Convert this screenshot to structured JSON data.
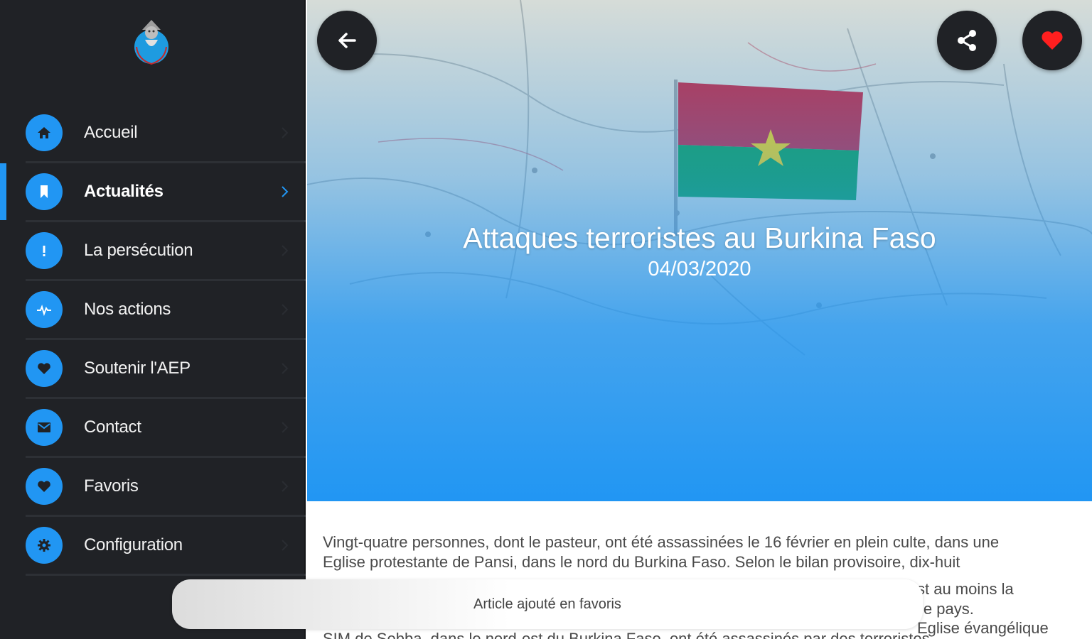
{
  "sidebar": {
    "items": [
      {
        "label": "Accueil",
        "icon": "home-icon"
      },
      {
        "label": "Actualités",
        "icon": "bookmark-icon",
        "active": true
      },
      {
        "label": "La persécution",
        "icon": "exclamation-icon"
      },
      {
        "label": "Nos actions",
        "icon": "pulse-icon"
      },
      {
        "label": "Soutenir l'AEP",
        "icon": "heart-icon"
      },
      {
        "label": "Contact",
        "icon": "mail-icon"
      },
      {
        "label": "Favoris",
        "icon": "heart-icon"
      },
      {
        "label": "Configuration",
        "icon": "gear-icon"
      }
    ]
  },
  "hero": {
    "title": "Attaques terroristes au Burkina Faso",
    "date": "04/03/2020"
  },
  "article": {
    "line1": "Vingt-quatre personnes, dont le pasteur, ont été assassinées le 16 février en plein culte, dans une",
    "line2": "Eglise protestante de Pansi, dans le nord du Burkina Faso. Selon le bilan provisoire, dix-huit",
    "line3_tail": "st au moins la",
    "line4_tail": "le pays.",
    "line5_tail": "Eglise évangélique",
    "line6": "SIM de Sebba, dans le nord-est du Burkina Faso, ont été assassinés par des terroristes."
  },
  "toast": {
    "message": "Article ajouté en favoris"
  },
  "colors": {
    "accent": "#2196f3",
    "sidebar_bg": "#202226",
    "favorite": "#ff1f1f"
  }
}
